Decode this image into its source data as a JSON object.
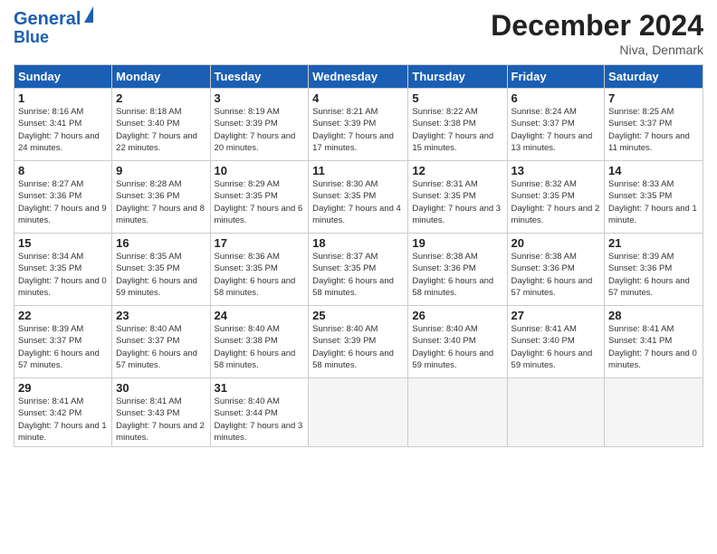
{
  "logo": {
    "line1": "General",
    "line2": "Blue"
  },
  "title": "December 2024",
  "location": "Niva, Denmark",
  "days_of_week": [
    "Sunday",
    "Monday",
    "Tuesday",
    "Wednesday",
    "Thursday",
    "Friday",
    "Saturday"
  ],
  "weeks": [
    [
      {
        "day": "1",
        "sunrise": "8:16 AM",
        "sunset": "3:41 PM",
        "daylight": "7 hours and 24 minutes."
      },
      {
        "day": "2",
        "sunrise": "8:18 AM",
        "sunset": "3:40 PM",
        "daylight": "7 hours and 22 minutes."
      },
      {
        "day": "3",
        "sunrise": "8:19 AM",
        "sunset": "3:39 PM",
        "daylight": "7 hours and 20 minutes."
      },
      {
        "day": "4",
        "sunrise": "8:21 AM",
        "sunset": "3:39 PM",
        "daylight": "7 hours and 17 minutes."
      },
      {
        "day": "5",
        "sunrise": "8:22 AM",
        "sunset": "3:38 PM",
        "daylight": "7 hours and 15 minutes."
      },
      {
        "day": "6",
        "sunrise": "8:24 AM",
        "sunset": "3:37 PM",
        "daylight": "7 hours and 13 minutes."
      },
      {
        "day": "7",
        "sunrise": "8:25 AM",
        "sunset": "3:37 PM",
        "daylight": "7 hours and 11 minutes."
      }
    ],
    [
      {
        "day": "8",
        "sunrise": "8:27 AM",
        "sunset": "3:36 PM",
        "daylight": "7 hours and 9 minutes."
      },
      {
        "day": "9",
        "sunrise": "8:28 AM",
        "sunset": "3:36 PM",
        "daylight": "7 hours and 8 minutes."
      },
      {
        "day": "10",
        "sunrise": "8:29 AM",
        "sunset": "3:35 PM",
        "daylight": "7 hours and 6 minutes."
      },
      {
        "day": "11",
        "sunrise": "8:30 AM",
        "sunset": "3:35 PM",
        "daylight": "7 hours and 4 minutes."
      },
      {
        "day": "12",
        "sunrise": "8:31 AM",
        "sunset": "3:35 PM",
        "daylight": "7 hours and 3 minutes."
      },
      {
        "day": "13",
        "sunrise": "8:32 AM",
        "sunset": "3:35 PM",
        "daylight": "7 hours and 2 minutes."
      },
      {
        "day": "14",
        "sunrise": "8:33 AM",
        "sunset": "3:35 PM",
        "daylight": "7 hours and 1 minute."
      }
    ],
    [
      {
        "day": "15",
        "sunrise": "8:34 AM",
        "sunset": "3:35 PM",
        "daylight": "7 hours and 0 minutes."
      },
      {
        "day": "16",
        "sunrise": "8:35 AM",
        "sunset": "3:35 PM",
        "daylight": "6 hours and 59 minutes."
      },
      {
        "day": "17",
        "sunrise": "8:36 AM",
        "sunset": "3:35 PM",
        "daylight": "6 hours and 58 minutes."
      },
      {
        "day": "18",
        "sunrise": "8:37 AM",
        "sunset": "3:35 PM",
        "daylight": "6 hours and 58 minutes."
      },
      {
        "day": "19",
        "sunrise": "8:38 AM",
        "sunset": "3:36 PM",
        "daylight": "6 hours and 58 minutes."
      },
      {
        "day": "20",
        "sunrise": "8:38 AM",
        "sunset": "3:36 PM",
        "daylight": "6 hours and 57 minutes."
      },
      {
        "day": "21",
        "sunrise": "8:39 AM",
        "sunset": "3:36 PM",
        "daylight": "6 hours and 57 minutes."
      }
    ],
    [
      {
        "day": "22",
        "sunrise": "8:39 AM",
        "sunset": "3:37 PM",
        "daylight": "6 hours and 57 minutes."
      },
      {
        "day": "23",
        "sunrise": "8:40 AM",
        "sunset": "3:37 PM",
        "daylight": "6 hours and 57 minutes."
      },
      {
        "day": "24",
        "sunrise": "8:40 AM",
        "sunset": "3:38 PM",
        "daylight": "6 hours and 58 minutes."
      },
      {
        "day": "25",
        "sunrise": "8:40 AM",
        "sunset": "3:39 PM",
        "daylight": "6 hours and 58 minutes."
      },
      {
        "day": "26",
        "sunrise": "8:40 AM",
        "sunset": "3:40 PM",
        "daylight": "6 hours and 59 minutes."
      },
      {
        "day": "27",
        "sunrise": "8:41 AM",
        "sunset": "3:40 PM",
        "daylight": "6 hours and 59 minutes."
      },
      {
        "day": "28",
        "sunrise": "8:41 AM",
        "sunset": "3:41 PM",
        "daylight": "7 hours and 0 minutes."
      }
    ],
    [
      {
        "day": "29",
        "sunrise": "8:41 AM",
        "sunset": "3:42 PM",
        "daylight": "7 hours and 1 minute."
      },
      {
        "day": "30",
        "sunrise": "8:41 AM",
        "sunset": "3:43 PM",
        "daylight": "7 hours and 2 minutes."
      },
      {
        "day": "31",
        "sunrise": "8:40 AM",
        "sunset": "3:44 PM",
        "daylight": "7 hours and 3 minutes."
      },
      null,
      null,
      null,
      null
    ]
  ]
}
